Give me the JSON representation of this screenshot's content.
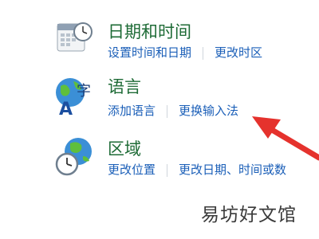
{
  "sections": [
    {
      "title": "日期和时间",
      "links": [
        "设置时间和日期",
        "更改时区"
      ],
      "icon": "calendar-clock-icon"
    },
    {
      "title": "语言",
      "links": [
        "添加语言",
        "更换输入法"
      ],
      "icon": "language-globe-icon"
    },
    {
      "title": "区域",
      "links": [
        "更改位置",
        "更改日期、时间或数"
      ],
      "icon": "globe-clock-icon"
    }
  ],
  "watermark": "易坊好文馆",
  "colors": {
    "title": "#1e6b36",
    "link": "#1b5fb8",
    "arrow": "#e5322d"
  }
}
